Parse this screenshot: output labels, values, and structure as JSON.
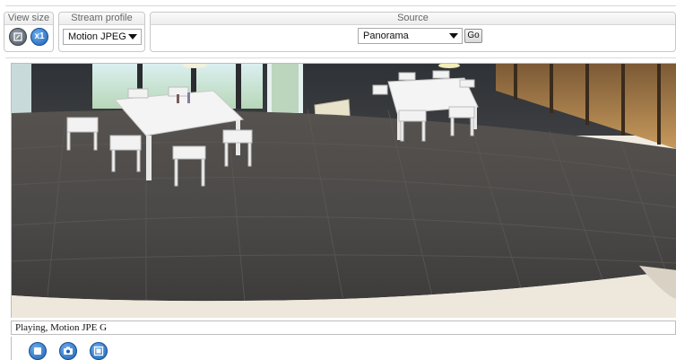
{
  "view_size": {
    "legend": "View size",
    "buttons": [
      {
        "name": "scale-icon"
      },
      {
        "name": "x1-icon",
        "label": "x1"
      }
    ]
  },
  "stream_profile": {
    "legend": "Stream profile",
    "selected": "Motion JPEG"
  },
  "source": {
    "legend": "Source",
    "selected": "Panorama",
    "go_label": "Go"
  },
  "video": {
    "content": "camera-panorama-view"
  },
  "status": {
    "text": "Playing, Motion JPE G"
  },
  "controls": [
    {
      "name": "stop-icon"
    },
    {
      "name": "snapshot-icon"
    },
    {
      "name": "view-full-icon"
    }
  ],
  "colors": {
    "accent_blue": "#1d5fb0",
    "border": "#c8c8c8",
    "floor": "#4a4847"
  }
}
